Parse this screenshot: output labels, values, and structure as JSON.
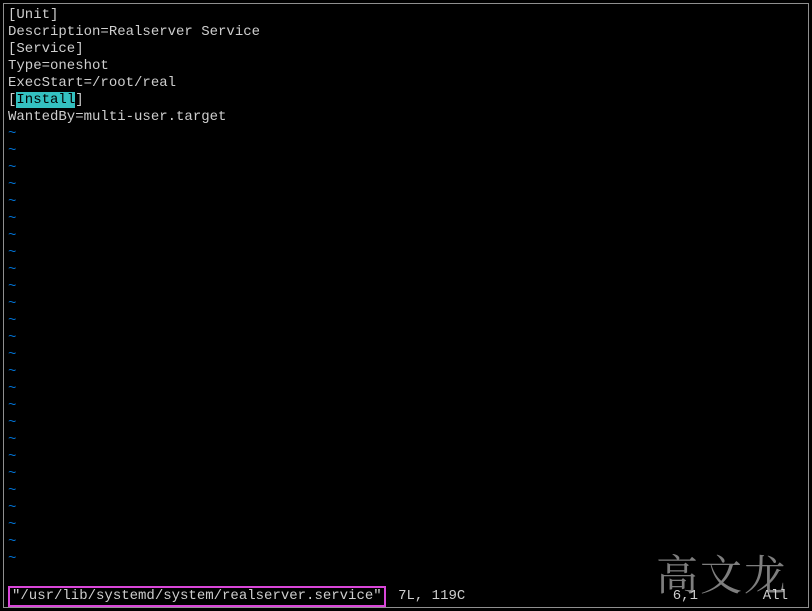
{
  "file": {
    "lines": [
      {
        "type": "plain",
        "text": "[Unit]"
      },
      {
        "type": "plain",
        "text": "Description=Realserver Service"
      },
      {
        "type": "plain",
        "text": "[Service]"
      },
      {
        "type": "plain",
        "text": "Type=oneshot"
      },
      {
        "type": "plain",
        "text": "ExecStart=/root/real"
      },
      {
        "type": "hl",
        "prefix": "[",
        "hl": "Install",
        "suffix": "]"
      },
      {
        "type": "plain",
        "text": "WantedBy=multi-user.target"
      }
    ]
  },
  "tilde": "~",
  "empty_line_count": 26,
  "status": {
    "filepath": "\"/usr/lib/systemd/system/realserver.service\"",
    "info": "7L, 119C",
    "cursor": "6,1",
    "scroll": "All"
  },
  "watermark": "高文龙"
}
